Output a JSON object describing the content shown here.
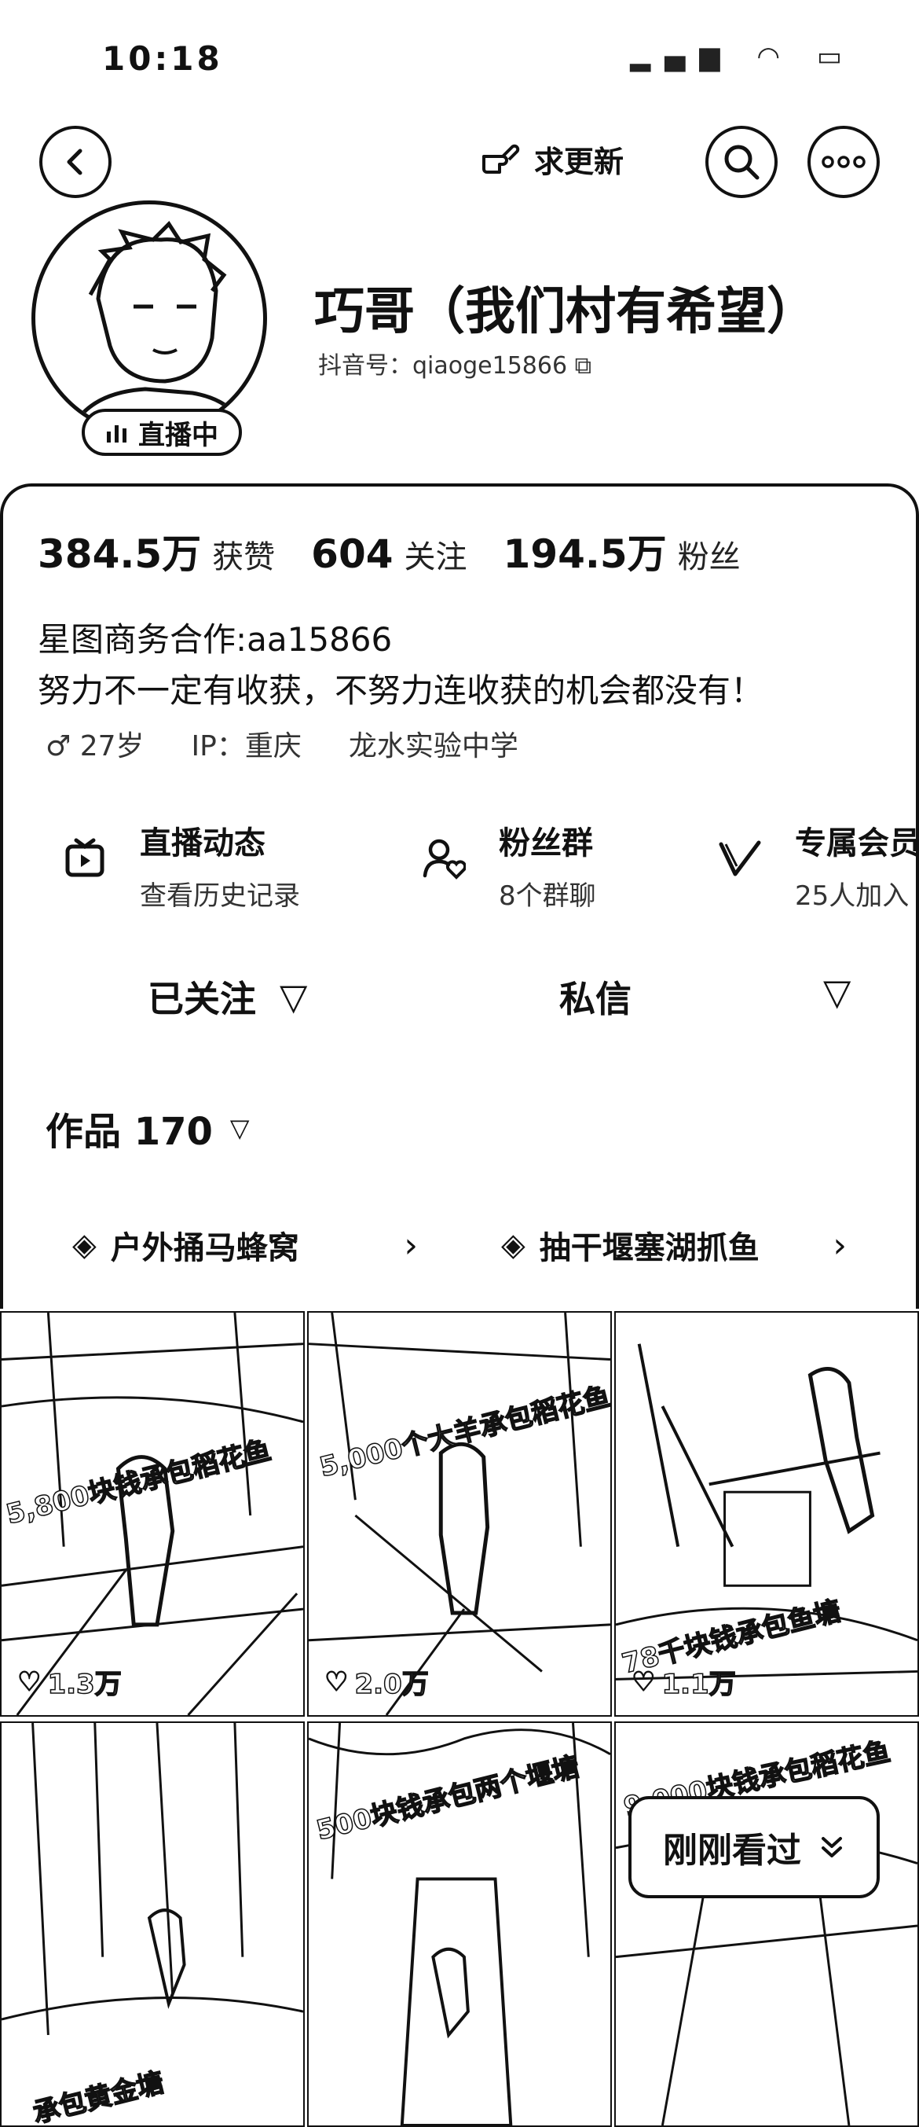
{
  "status_bar": {
    "time": "10:18"
  },
  "nav": {
    "update_label": "求更新"
  },
  "profile": {
    "name": "巧哥（我们村有希望）",
    "douyin_id": "抖音号：qiaoge15866",
    "live_badge": "直播中"
  },
  "stats": [
    {
      "value": "384.5万",
      "label": "获赞"
    },
    {
      "value": "604",
      "label": "关注"
    },
    {
      "value": "194.5万",
      "label": "粉丝"
    }
  ],
  "bio": {
    "business": "星图商务合作:aa15866",
    "motto": "努力不一定有收获，不努力连收获的机会都没有！",
    "gender_age": "♂ 27岁",
    "ip": "IP：重庆",
    "school": "龙水实验中学"
  },
  "shortcuts": [
    {
      "title": "直播动态",
      "subtitle": "查看历史记录",
      "icon": "tv-play-icon"
    },
    {
      "title": "粉丝群",
      "subtitle": "8个群聊",
      "icon": "user-heart-icon"
    },
    {
      "title": "专属会员",
      "subtitle": "25人加入",
      "icon": "v-badge-icon"
    }
  ],
  "actions": {
    "follow_label": "已关注",
    "message_label": "私信"
  },
  "works": {
    "tab_label": "作品 170"
  },
  "collections": [
    {
      "label": "户外捅马蜂窝"
    },
    {
      "label": "抽干堰塞湖抓鱼"
    }
  ],
  "videos": [
    {
      "caption": "5,800块钱承包稻花鱼",
      "likes": "1.3万"
    },
    {
      "caption": "5,000个大羊承包稻花鱼",
      "likes": "2.0万"
    },
    {
      "caption": "78千块钱承包鱼塘",
      "likes": "1.1万"
    },
    {
      "caption": "承包黄金塘",
      "likes": ""
    },
    {
      "caption": "500块钱承包两个堰塘",
      "likes": ""
    },
    {
      "caption": "9,000块钱承包稻花鱼",
      "likes": ""
    }
  ],
  "recent": {
    "label": "刚刚看过"
  }
}
